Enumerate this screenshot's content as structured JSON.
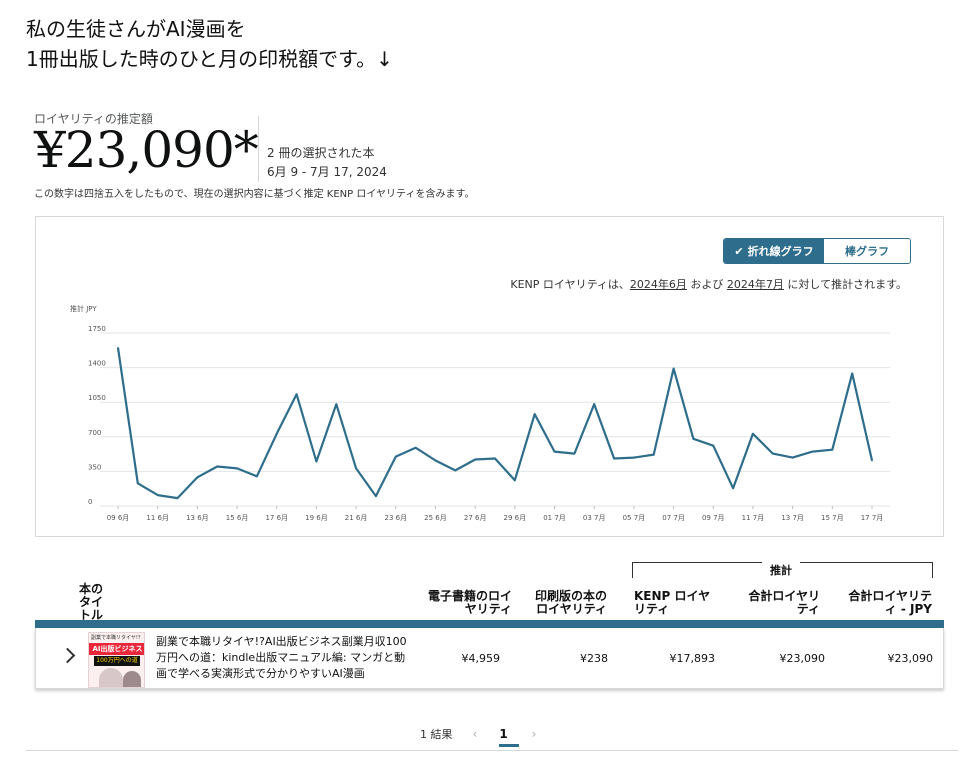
{
  "intro": {
    "line1": "私の生徒さんがAI漫画を",
    "line2": "1冊出版した時のひと月の印税額です。↓"
  },
  "estimate": {
    "label": "ロイヤリティの推定額",
    "amount": "¥23,090*",
    "books_selected": "2 冊の選択された本",
    "date_range": "6月 9 - 7月 17, 2024",
    "note": "この数字は四捨五入をしたもので、現在の選択内容に基づく推定 KENP ロイヤリティを含みます。"
  },
  "chart_toggle": {
    "line_label": "折れ線グラフ",
    "bar_label": "棒グラフ",
    "selected": "line"
  },
  "kenp_note": {
    "prefix": "KENP ロイヤリティは、",
    "month1": "2024年6月",
    "and": " および ",
    "month2": "2024年7月",
    "suffix": " に対して推計されます。"
  },
  "chart_data": {
    "type": "line",
    "ylabel": "推計 JPY",
    "ylim": [
      0,
      1750
    ],
    "yticks": [
      "1750",
      "1400",
      "1050",
      "700",
      "350",
      "0"
    ],
    "grid": true,
    "line_color": "#2e6e8c",
    "xtick_labels": [
      "09 6月",
      "11 6月",
      "13 6月",
      "15 6月",
      "17 6月",
      "19 6月",
      "21 6月",
      "23 6月",
      "25 6月",
      "27 6月",
      "29 6月",
      "01 7月",
      "03 7月",
      "05 7月",
      "07 7月",
      "09 7月",
      "11 7月",
      "13 7月",
      "15 7月",
      "17 7月"
    ],
    "x": [
      "6/9",
      "6/10",
      "6/11",
      "6/12",
      "6/13",
      "6/14",
      "6/15",
      "6/16",
      "6/17",
      "6/18",
      "6/19",
      "6/20",
      "6/21",
      "6/22",
      "6/23",
      "6/24",
      "6/25",
      "6/26",
      "6/27",
      "6/28",
      "6/29",
      "6/30",
      "7/1",
      "7/2",
      "7/3",
      "7/4",
      "7/5",
      "7/6",
      "7/7",
      "7/8",
      "7/9",
      "7/10",
      "7/11",
      "7/12",
      "7/13",
      "7/14",
      "7/15",
      "7/16",
      "7/17"
    ],
    "values": [
      1600,
      230,
      110,
      80,
      290,
      400,
      380,
      300,
      730,
      1130,
      450,
      1030,
      380,
      100,
      500,
      590,
      460,
      360,
      470,
      480,
      260,
      930,
      550,
      530,
      1030,
      480,
      490,
      520,
      1390,
      680,
      610,
      180,
      730,
      530,
      490,
      550,
      570,
      1340,
      460
    ]
  },
  "table": {
    "headers": {
      "title": "本のタイトル",
      "ebook": "電子書籍のロイヤリティ",
      "print": "印刷版の本のロイヤリティ",
      "estimate_group": "推計",
      "kenp": "KENP ロイヤリティ",
      "total": "合計ロイヤリティ",
      "total_jpy": "合計ロイヤリティ - JPY"
    },
    "rows": [
      {
        "cover_text_top": "副業で本職リタイヤ!?",
        "cover_text_band": "AI出版ビジネス",
        "cover_text_badge": "100万円への道",
        "title": "副業で本職リタイヤ!?AI出版ビジネス副業月収100万円への道：kindle出版マニュアル編: マンガと動画で学べる実演形式で分かりやすいAI漫画",
        "ebook": "¥4,959",
        "print": "¥238",
        "kenp": "¥17,893",
        "total": "¥23,090",
        "total_jpy": "¥23,090"
      }
    ]
  },
  "pagination": {
    "results": "1 結果",
    "prev": "‹",
    "current": "1",
    "next": "›"
  }
}
